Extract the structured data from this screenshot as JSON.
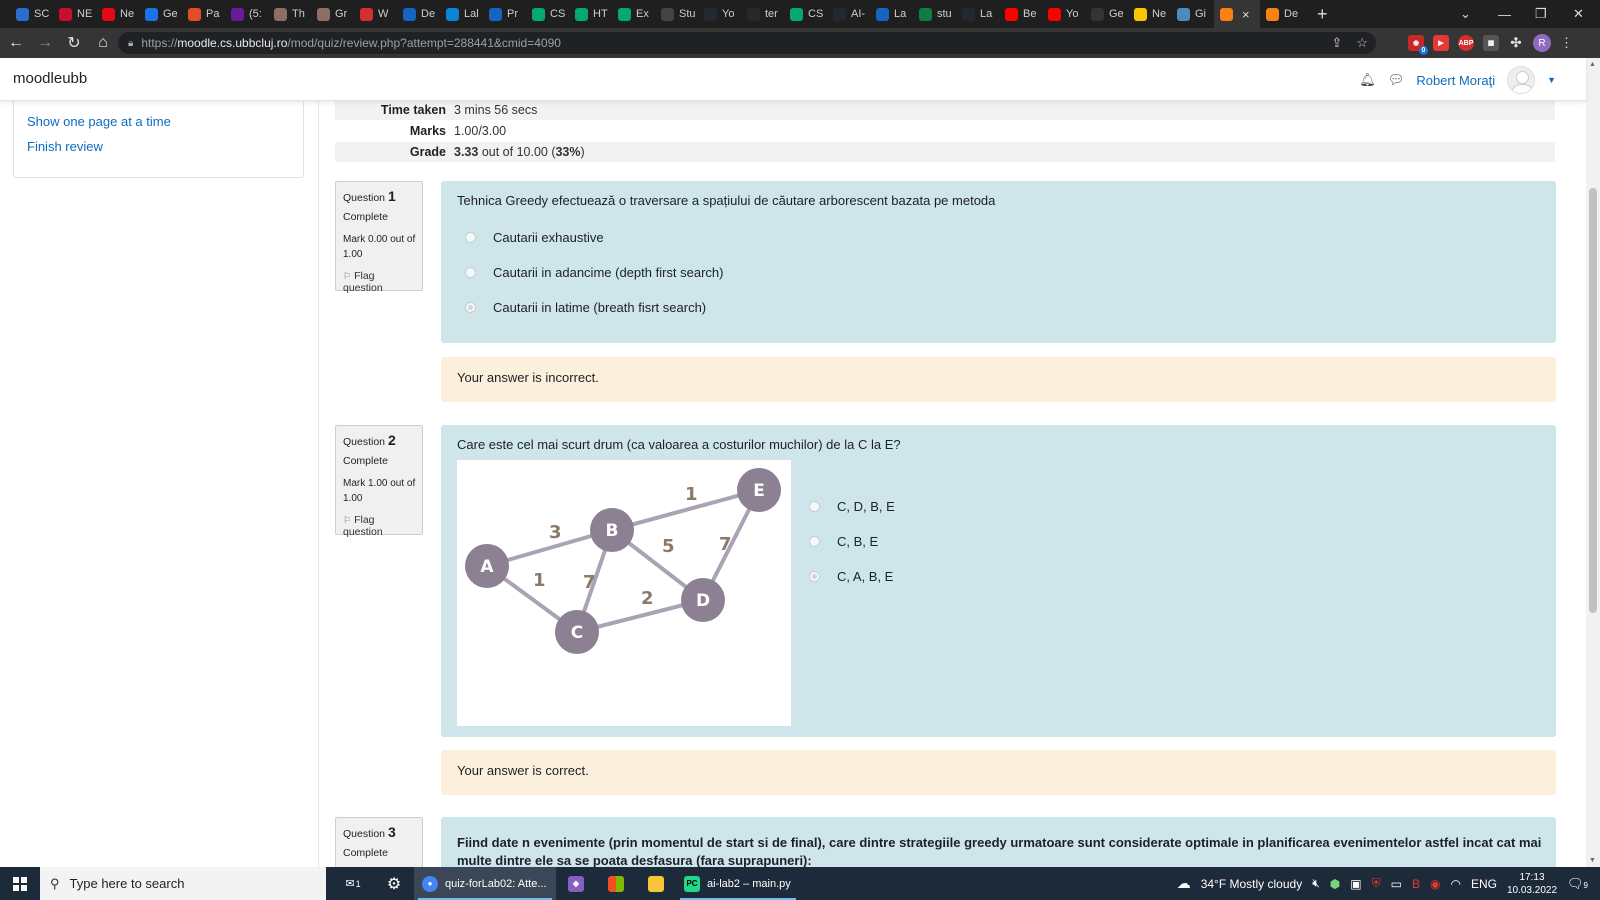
{
  "browser": {
    "tabs": [
      {
        "label": "SC",
        "icon": "tab-favicon-icon",
        "color": "#2b6dd1"
      },
      {
        "label": "NE",
        "icon": "tab-favicon-icon",
        "color": "#c8102e"
      },
      {
        "label": "Ne",
        "icon": "netflix-icon",
        "color": "#e50914"
      },
      {
        "label": "Ge",
        "icon": "tab-favicon-icon",
        "color": "#1a73e8"
      },
      {
        "label": "Pa",
        "icon": "tab-favicon-icon",
        "color": "#e34c26"
      },
      {
        "label": "(5:",
        "icon": "tab-favicon-icon",
        "color": "#6a1b9a"
      },
      {
        "label": "Th",
        "icon": "tab-favicon-icon",
        "color": "#8d6e63"
      },
      {
        "label": "Gr",
        "icon": "tab-favicon-icon",
        "color": "#8d6e63"
      },
      {
        "label": "W",
        "icon": "tab-favicon-icon",
        "color": "#d32f2f"
      },
      {
        "label": "De",
        "icon": "tab-favicon-icon",
        "color": "#1565c0"
      },
      {
        "label": "Lal",
        "icon": "onedrive-icon",
        "color": "#0a84d6"
      },
      {
        "label": "Pr",
        "icon": "tab-favicon-icon",
        "color": "#1565c0"
      },
      {
        "label": "CS",
        "icon": "w3schools-icon",
        "color": "#04aa6d"
      },
      {
        "label": "HT",
        "icon": "w3schools-icon",
        "color": "#04aa6d"
      },
      {
        "label": "Ex",
        "icon": "w3schools-icon",
        "color": "#04aa6d"
      },
      {
        "label": "Stu",
        "icon": "tab-favicon-icon",
        "color": "#444"
      },
      {
        "label": "Yo",
        "icon": "github-icon",
        "color": "#24292f"
      },
      {
        "label": "ter",
        "icon": "github-icon",
        "color": "#24292f"
      },
      {
        "label": "CS",
        "icon": "w3schools-icon",
        "color": "#04aa6d"
      },
      {
        "label": "AI-",
        "icon": "github-icon",
        "color": "#24292f"
      },
      {
        "label": "La",
        "icon": "tab-favicon-icon",
        "color": "#1565c0"
      },
      {
        "label": "stu",
        "icon": "excel-icon",
        "color": "#107c41"
      },
      {
        "label": "La",
        "icon": "github-icon",
        "color": "#24292f"
      },
      {
        "label": "Be",
        "icon": "youtube-icon",
        "color": "#ff0000"
      },
      {
        "label": "Yo",
        "icon": "youtube-icon",
        "color": "#ff0000"
      },
      {
        "label": "Ge",
        "icon": "tab-favicon-icon",
        "color": "#333"
      },
      {
        "label": "Ne",
        "icon": "tab-favicon-icon",
        "color": "#f7c600"
      },
      {
        "label": "Gi",
        "icon": "tab-favicon-icon",
        "color": "#4b8bbe"
      },
      {
        "label": "",
        "icon": "moodle-icon",
        "color": "#f98012",
        "active": true
      },
      {
        "label": "De",
        "icon": "tab-favicon-icon",
        "color": "#f98012"
      }
    ],
    "url_prefix": "https://",
    "url_host": "moodle.cs.ubbcluj.ro",
    "url_path": "/mod/quiz/review.php?attempt=288441&cmid=4090",
    "profile_letter": "R",
    "ext_badge": "0"
  },
  "navbar": {
    "brand": "moodleubb",
    "user_name": "Robert Moraţi"
  },
  "block": {
    "links": [
      "Show one page at a time",
      "Finish review"
    ]
  },
  "summary": [
    {
      "label": "Time taken",
      "value": "3 mins 56 secs"
    },
    {
      "label": "Marks",
      "value": "1.00/3.00"
    },
    {
      "label": "Grade",
      "value_bold": "3.33",
      "value_mid": " out of 10.00 (",
      "value_pct": "33%",
      "value_end": ")"
    }
  ],
  "questions": [
    {
      "prefix": "Question",
      "number": "1",
      "state": "Complete",
      "mark": "Mark 0.00 out of 1.00",
      "flag": "Flag question",
      "text": "Tehnica Greedy efectuează o traversare a spațiului de căutare arborescent bazata pe metoda",
      "options": [
        "Cautarii exhaustive",
        "Cautarii in adancime (depth first search)",
        "Cautarii in latime (breath fisrt search)"
      ],
      "selected": 2,
      "feedback": "Your answer is incorrect."
    },
    {
      "prefix": "Question",
      "number": "2",
      "state": "Complete",
      "mark": "Mark 1.00 out of 1.00",
      "flag": "Flag question",
      "text": "Care este cel mai scurt drum (ca valoarea a costurilor muchilor) de la C la E?",
      "options": [
        "C, D, B, E",
        "C, B, E",
        "C, A, B, E"
      ],
      "selected": 2,
      "feedback": "Your answer is correct.",
      "graph": {
        "nodes": [
          "A",
          "B",
          "C",
          "D",
          "E"
        ],
        "edges": [
          {
            "from": "A",
            "to": "B",
            "weight": "3"
          },
          {
            "from": "A",
            "to": "C",
            "weight": "1"
          },
          {
            "from": "B",
            "to": "C",
            "weight": "7"
          },
          {
            "from": "B",
            "to": "D",
            "weight": "5"
          },
          {
            "from": "B",
            "to": "E",
            "weight": "1"
          },
          {
            "from": "C",
            "to": "D",
            "weight": "2"
          },
          {
            "from": "D",
            "to": "E",
            "weight": "7"
          }
        ],
        "node_color": "#8b8193",
        "edge_color": "#a9a3b3",
        "weight_color": "#8b7a6a"
      }
    },
    {
      "prefix": "Question",
      "number": "3",
      "state": "Complete",
      "text": "Fiind date n evenimente (prin momentul de start si de final), care dintre strategiile greedy urmatoare sunt considerate optimale in planificarea evenimentelor astfel incat cat mai multe dintre ele sa se poata desfasura (fara suprapuneri):"
    }
  ],
  "taskbar": {
    "search_placeholder": "Type here to search",
    "mail_badge": "1",
    "chrome_title": "quiz-forLab02: Atte...",
    "pycharm_title": "ai-lab2 – main.py",
    "weather": "34°F  Mostly cloudy",
    "language": "ENG",
    "time": "17:13",
    "date": "10.03.2022",
    "notif_count": "9"
  },
  "colors": {
    "link": "#0f6cbf",
    "question_bg": "#cee5e9",
    "feedback_bg": "#fcefdc",
    "info_bg": "#f0f0f0"
  }
}
